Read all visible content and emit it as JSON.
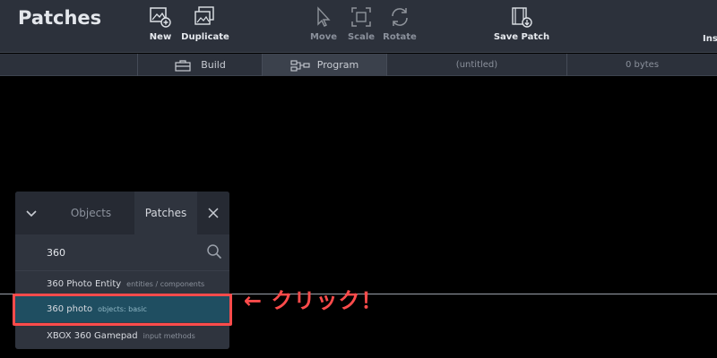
{
  "app": {
    "title": "Patches"
  },
  "toolbar": {
    "new_label": "New",
    "duplicate_label": "Duplicate",
    "move_label": "Move",
    "scale_label": "Scale",
    "rotate_label": "Rotate",
    "save_patch_label": "Save Patch",
    "cut_label": "Ins",
    "icons": {
      "new": "image-plus-icon",
      "duplicate": "images-stack-icon",
      "move": "cursor-arrow-icon",
      "scale": "scale-frame-icon",
      "rotate": "rotate-arrows-icon",
      "save": "film-download-icon"
    }
  },
  "subbar": {
    "build_label": "Build",
    "program_label": "Program",
    "file_name": "(untitled)",
    "file_size": "0 bytes"
  },
  "panel": {
    "tabs": [
      "Objects",
      "Patches"
    ],
    "active_tab": "Patches",
    "search_value": "360",
    "results": [
      {
        "name": "360 Photo Entity",
        "tag": "entities / components"
      },
      {
        "name": "360 photo",
        "tag": "objects: basic",
        "selected": true
      },
      {
        "name": "XBOX 360 Gamepad",
        "tag": "input methods"
      }
    ]
  },
  "annotation": {
    "text": "← クリック！",
    "color": "#ff4b4b"
  },
  "colors": {
    "toolbar_bg": "#2c313b",
    "panel_bg": "#2f343e",
    "selected_row": "#1f4e61",
    "accent_red": "#ff4b4b"
  }
}
